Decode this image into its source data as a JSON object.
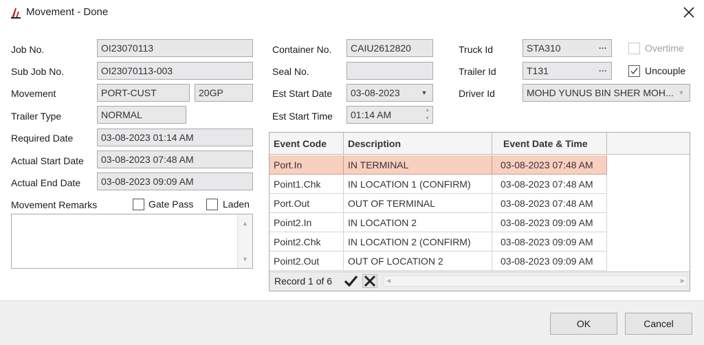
{
  "window": {
    "title": "Movement - Done"
  },
  "form": {
    "job_no": {
      "label": "Job No.",
      "value": "OI23070113"
    },
    "sub_job_no": {
      "label": "Sub Job No.",
      "value": "OI23070113-003"
    },
    "movement": {
      "label": "Movement",
      "value": "PORT-CUST",
      "size": "20GP"
    },
    "trailer_type": {
      "label": "Trailer Type",
      "value": "NORMAL"
    },
    "required_date": {
      "label": "Required Date",
      "value": "03-08-2023 01:14 AM"
    },
    "actual_start_date": {
      "label": "Actual Start Date",
      "value": "03-08-2023 07:48 AM"
    },
    "actual_end_date": {
      "label": "Actual End Date",
      "value": "03-08-2023 09:09 AM"
    },
    "remarks": {
      "label": "Movement Remarks",
      "value": ""
    },
    "gate_pass": {
      "label": "Gate Pass",
      "checked": false
    },
    "laden": {
      "label": "Laden",
      "checked": false
    },
    "container_no": {
      "label": "Container No.",
      "value": "CAIU2612820"
    },
    "seal_no": {
      "label": "Seal No.",
      "value": ""
    },
    "est_start_date": {
      "label": "Est Start Date",
      "value": "03-08-2023"
    },
    "est_start_time": {
      "label": "Est Start Time",
      "value": "01:14 AM"
    },
    "truck_id": {
      "label": "Truck Id",
      "value": "STA310",
      "button": "···"
    },
    "trailer_id": {
      "label": "Trailer Id",
      "value": "T131",
      "button": "···"
    },
    "driver_id": {
      "label": "Driver Id",
      "value": "MOHD YUNUS BIN SHER MOH..."
    },
    "overtime": {
      "label": "Overtime",
      "checked": false,
      "enabled": false
    },
    "uncouple": {
      "label": "Uncouple",
      "checked": true
    }
  },
  "events": {
    "columns": [
      "Event Code",
      "Description",
      "Event Date & Time"
    ],
    "rows": [
      {
        "code": "Port.In",
        "desc": "IN TERMINAL",
        "dt": "03-08-2023 07:48 AM"
      },
      {
        "code": "Point1.Chk",
        "desc": "IN LOCATION 1 (CONFIRM)",
        "dt": "03-08-2023 07:48 AM"
      },
      {
        "code": "Port.Out",
        "desc": "OUT OF TERMINAL",
        "dt": "03-08-2023 07:48 AM"
      },
      {
        "code": "Point2.In",
        "desc": "IN LOCATION 2",
        "dt": "03-08-2023 09:09 AM"
      },
      {
        "code": "Point2.Chk",
        "desc": "IN LOCATION 2 (CONFIRM)",
        "dt": "03-08-2023 09:09 AM"
      },
      {
        "code": "Point2.Out",
        "desc": "OUT OF LOCATION 2",
        "dt": "03-08-2023 09:09 AM"
      }
    ],
    "record_text": "Record 1 of 6"
  },
  "buttons": {
    "ok": "OK",
    "cancel": "Cancel"
  },
  "colors": {
    "selected_row": "#f9cfc0",
    "field_bg": "#e8e8ea",
    "footer_bg": "#f0f0f0"
  }
}
